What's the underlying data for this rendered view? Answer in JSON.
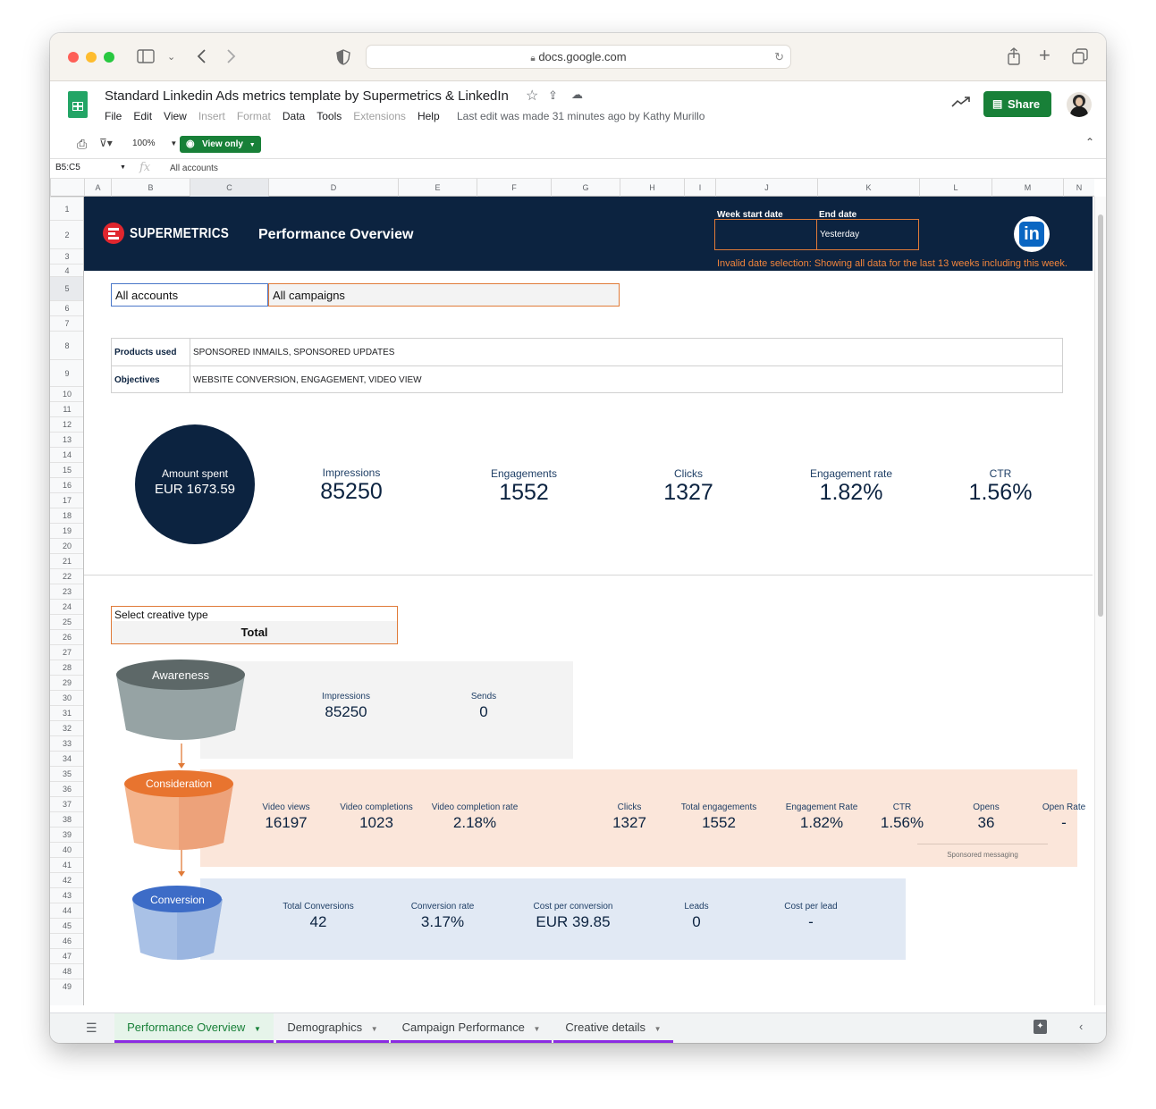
{
  "browser": {
    "url": "docs.google.com"
  },
  "doc": {
    "title": "Standard Linkedin Ads metrics template by Supermetrics & LinkedIn",
    "menus": [
      "File",
      "Edit",
      "View",
      "Insert",
      "Format",
      "Data",
      "Tools",
      "Extensions",
      "Help"
    ],
    "last_edit": "Last edit was made 31 minutes ago by Kathy Murillo",
    "share_label": "Share"
  },
  "toolbar": {
    "zoom": "100%",
    "view_only_label": "View only"
  },
  "formula_bar": {
    "cell_ref": "B5:C5",
    "fx": "fx",
    "content": "All accounts"
  },
  "columns": [
    "A",
    "B",
    "C",
    "D",
    "E",
    "F",
    "G",
    "H",
    "I",
    "J",
    "K",
    "L",
    "M",
    "N"
  ],
  "rows": [
    "1",
    "2",
    "3",
    "4",
    "5",
    "6",
    "7",
    "8",
    "9",
    "10",
    "11",
    "12",
    "13",
    "14",
    "15",
    "16",
    "17",
    "18",
    "19",
    "20",
    "21",
    "22",
    "23",
    "24",
    "25",
    "26",
    "27",
    "28",
    "29",
    "30",
    "31",
    "32",
    "33",
    "34",
    "35",
    "36",
    "37",
    "38",
    "39",
    "40",
    "41",
    "42",
    "43",
    "44",
    "45",
    "46",
    "47",
    "48",
    "49"
  ],
  "banner": {
    "brand": "SUPERMETRICS",
    "title": "Performance Overview",
    "week_start_label": "Week start date",
    "week_start_value": "",
    "end_date_label": "End date",
    "end_date_value": "Yesterday",
    "warning": "Invalid date selection: Showing all data for the last 13 weeks including this week.",
    "linkedin_logo": "in"
  },
  "filters": {
    "account": "All accounts",
    "campaign": "All campaigns"
  },
  "info": {
    "products_label": "Products used",
    "products_value": "SPONSORED INMAILS, SPONSORED UPDATES",
    "objectives_label": "Objectives",
    "objectives_value": "WEBSITE CONVERSION, ENGAGEMENT, VIDEO VIEW"
  },
  "summary": {
    "amount_label": "Amount spent",
    "amount_value": "EUR 1673.59",
    "kpis": [
      {
        "label": "Impressions",
        "value": "85250"
      },
      {
        "label": "Engagements",
        "value": "1552"
      },
      {
        "label": "Clicks",
        "value": "1327"
      },
      {
        "label": "Engagement rate",
        "value": "1.82%"
      },
      {
        "label": "CTR",
        "value": "1.56%"
      }
    ]
  },
  "creative": {
    "label": "Select creative type",
    "value": "Total"
  },
  "funnel": {
    "awareness": {
      "title": "Awareness",
      "metrics": [
        {
          "label": "Impressions",
          "value": "85250"
        },
        {
          "label": "Sends",
          "value": "0"
        }
      ]
    },
    "consideration": {
      "title": "Consideration",
      "metrics": [
        {
          "label": "Video views",
          "value": "16197"
        },
        {
          "label": "Video completions",
          "value": "1023"
        },
        {
          "label": "Video completion rate",
          "value": "2.18%"
        },
        {
          "label": "Clicks",
          "value": "1327"
        },
        {
          "label": "Total engagements",
          "value": "1552"
        },
        {
          "label": "Engagement Rate",
          "value": "1.82%"
        },
        {
          "label": "CTR",
          "value": "1.56%"
        },
        {
          "label": "Opens",
          "value": "36"
        },
        {
          "label": "Open Rate",
          "value": "-"
        }
      ],
      "note": "Sponsored messaging"
    },
    "conversion": {
      "title": "Conversion",
      "metrics": [
        {
          "label": "Total Conversions",
          "value": "42"
        },
        {
          "label": "Conversion rate",
          "value": "3.17%"
        },
        {
          "label": "Cost per conversion",
          "value": "EUR 39.85"
        },
        {
          "label": "Leads",
          "value": "0"
        },
        {
          "label": "Cost per lead",
          "value": "-"
        }
      ]
    }
  },
  "tabs": [
    "Performance Overview",
    "Demographics",
    "Campaign Performance",
    "Creative details"
  ],
  "colors": {
    "navy": "#0c2340",
    "orange": "#e07b39",
    "green": "#188038",
    "tab_underline": "#8b2be2"
  }
}
